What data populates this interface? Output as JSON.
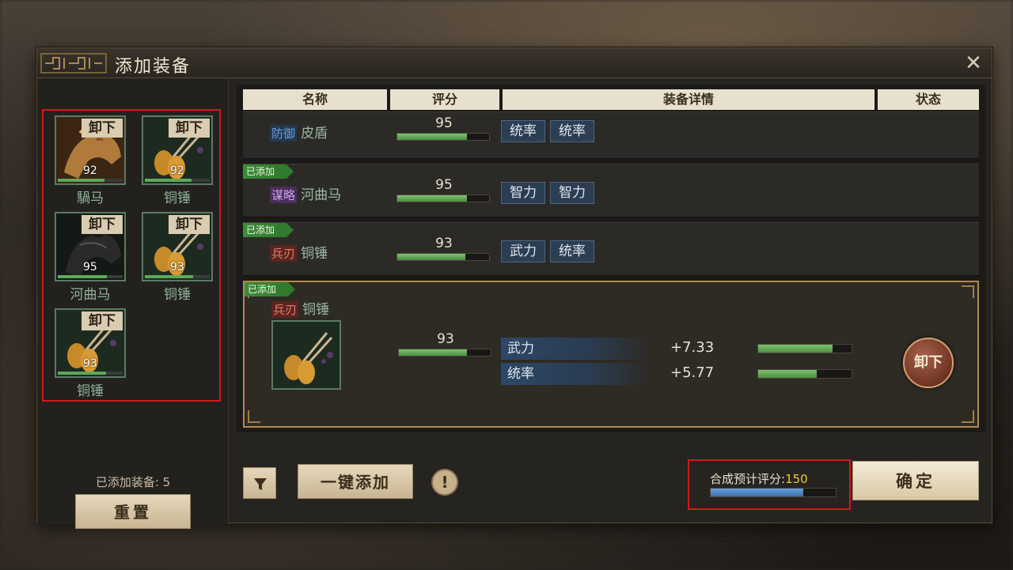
{
  "dialog": {
    "title": "添加装备"
  },
  "left": {
    "slots": [
      {
        "name": "騧马",
        "score": "92",
        "unequip": "卸下",
        "icon": "horse-icon",
        "bar": 0.72
      },
      {
        "name": "铜锤",
        "score": "92",
        "unequip": "卸下",
        "icon": "mace-icon",
        "bar": 0.72
      },
      {
        "name": "河曲马",
        "score": "95",
        "unequip": "卸下",
        "icon": "horse-icon",
        "bar": 0.76
      },
      {
        "name": "铜锤",
        "score": "93",
        "unequip": "卸下",
        "icon": "mace-icon",
        "bar": 0.74
      },
      {
        "name": "铜锤",
        "score": "93",
        "unequip": "卸下",
        "icon": "mace-icon",
        "bar": 0.74
      }
    ],
    "added_count_label": "已添加装备: 5",
    "reset_label": "重置"
  },
  "table": {
    "headers": [
      "名称",
      "评分",
      "装备详情",
      "状态"
    ],
    "rows": [
      {
        "added": "",
        "type": "防御",
        "type_color": "#6a9ed8",
        "name": "皮盾",
        "score": "95",
        "bar": 0.76,
        "attrs": [
          "统率",
          "统率"
        ]
      },
      {
        "added": "已添加",
        "type": "谋略",
        "type_color": "#b58ad8",
        "name": "河曲马",
        "score": "95",
        "bar": 0.76,
        "attrs": [
          "智力",
          "智力"
        ]
      },
      {
        "added": "已添加",
        "type": "兵刃",
        "type_color": "#d86a5a",
        "name": "铜锤",
        "score": "93",
        "bar": 0.74,
        "attrs": [
          "武力",
          "统率"
        ]
      }
    ],
    "expanded": {
      "added": "已添加",
      "type": "兵刃",
      "type_color": "#d86a5a",
      "name": "铜锤",
      "score": "93",
      "bar": 0.74,
      "stats": [
        {
          "label": "武力",
          "value": "+7.33",
          "bar": 0.8
        },
        {
          "label": "统率",
          "value": "+5.77",
          "bar": 0.63
        }
      ],
      "unequip_label": "卸下"
    }
  },
  "bottom": {
    "onekey_label": "一键添加",
    "info_label": "!",
    "score_label": "合成预计评分:",
    "score_value": "150",
    "score_bar": 0.74,
    "confirm_label": "确定"
  }
}
